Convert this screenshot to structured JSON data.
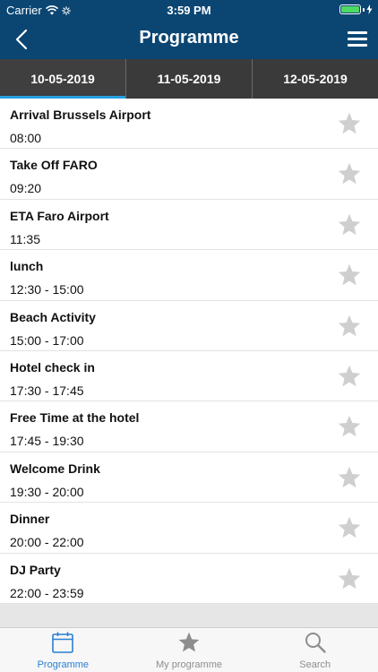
{
  "status": {
    "carrier": "Carrier",
    "time": "3:59 PM"
  },
  "nav": {
    "title": "Programme"
  },
  "tabs": [
    "10-05-2019",
    "11-05-2019",
    "12-05-2019"
  ],
  "active_tab": 0,
  "items": [
    {
      "name": "Arrival Brussels Airport",
      "time": "08:00"
    },
    {
      "name": "Take Off FARO",
      "time": "09:20"
    },
    {
      "name": "ETA Faro Airport",
      "time": "11:35"
    },
    {
      "name": "lunch",
      "time": "12:30 - 15:00"
    },
    {
      "name": "Beach Activity",
      "time": "15:00 - 17:00"
    },
    {
      "name": "Hotel check in",
      "time": "17:30 - 17:45"
    },
    {
      "name": "Free Time at the hotel",
      "time": "17:45 - 19:30"
    },
    {
      "name": "Welcome Drink",
      "time": "19:30 - 20:00"
    },
    {
      "name": "Dinner",
      "time": "20:00 - 22:00"
    },
    {
      "name": "DJ Party",
      "time": "22:00 - 23:59"
    }
  ],
  "tabbar": [
    {
      "label": "Programme",
      "icon": "calendar-icon"
    },
    {
      "label": "My programme",
      "icon": "star-icon"
    },
    {
      "label": "Search",
      "icon": "search-icon"
    }
  ],
  "colors": {
    "nav": "#0b4673",
    "accent": "#27a0e0",
    "tab_active": "#2a7fd4",
    "star": "#cfcfcf"
  }
}
